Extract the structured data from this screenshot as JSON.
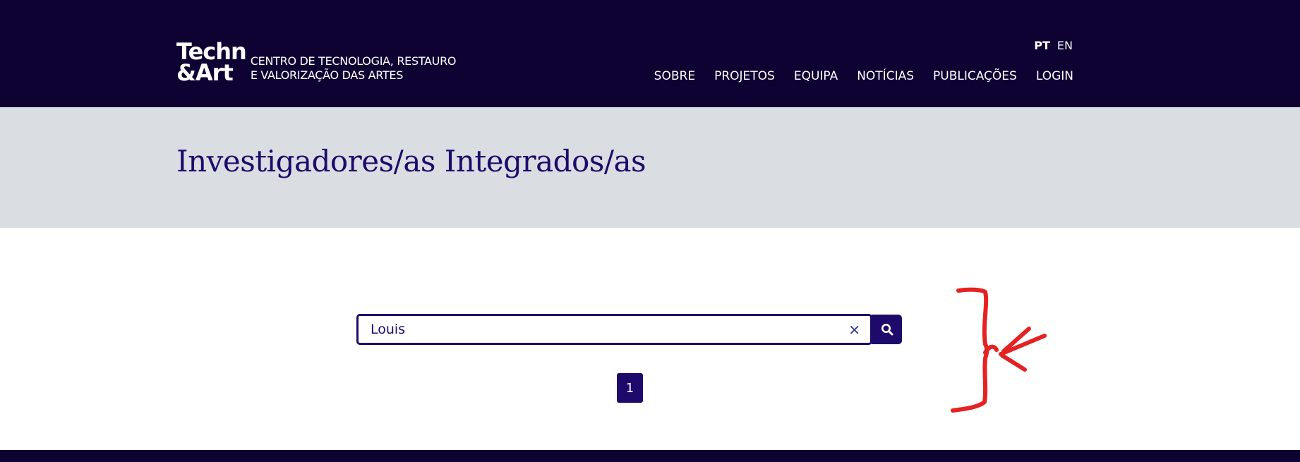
{
  "header": {
    "logo": {
      "mark_line1": "Techn",
      "mark_line2": "&Art",
      "tagline_line1": "CENTRO DE TECNOLOGIA, RESTAURO",
      "tagline_line2": "E VALORIZAÇÃO DAS ARTES"
    },
    "languages": [
      {
        "label": "PT",
        "active": true
      },
      {
        "label": "EN",
        "active": false
      }
    ],
    "nav": [
      {
        "label": "SOBRE"
      },
      {
        "label": "PROJETOS"
      },
      {
        "label": "EQUIPA"
      },
      {
        "label": "NOTÍCIAS"
      },
      {
        "label": "PUBLICAÇÕES"
      },
      {
        "label": "LOGIN"
      }
    ]
  },
  "banner": {
    "title": "Investigadores/as Integrados/as"
  },
  "search": {
    "value": "Louis",
    "clear_icon": "close-icon",
    "search_icon": "search-icon"
  },
  "pagination": {
    "current_page": "1"
  },
  "colors": {
    "header_bg": "#0e0233",
    "accent": "#1e0a6b",
    "banner_bg": "#dadde1",
    "annotation": "#e52222"
  }
}
